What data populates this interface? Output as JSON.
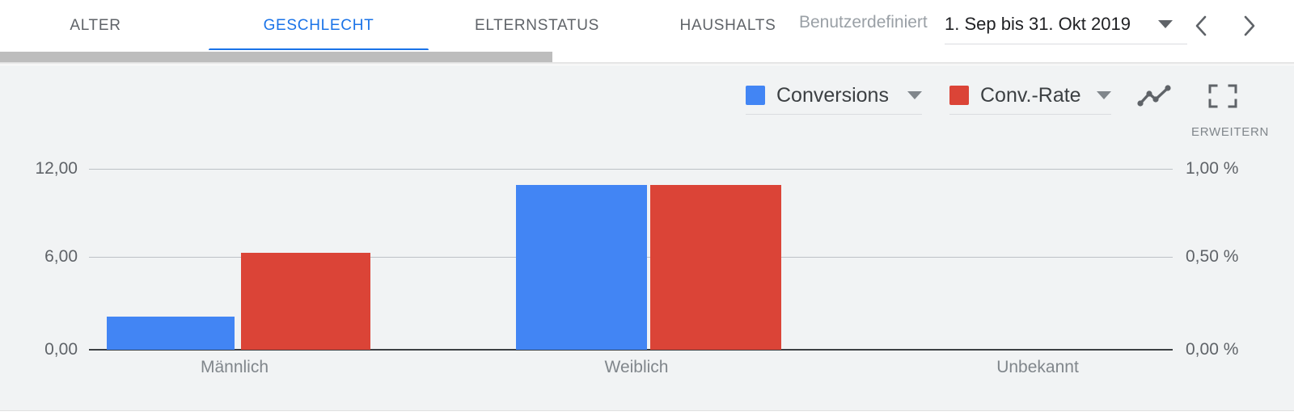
{
  "header": {
    "tabs": [
      {
        "label": "ALTER",
        "active": false
      },
      {
        "label": "GESCHLECHT",
        "active": true
      },
      {
        "label": "ELTERNSTATUS",
        "active": false
      },
      {
        "label": "HAUSHALTS",
        "active": false
      }
    ],
    "date_picker": {
      "label": "Benutzerdefiniert",
      "value": "1. Sep bis 31. Okt 2019",
      "dropdown_icon": "chevron-down-icon",
      "prev_icon": "chevron-left-icon",
      "next_icon": "chevron-right-icon"
    }
  },
  "toolbar": {
    "legend": [
      {
        "label": "Conversions",
        "color": "#4285F4",
        "dropdown_icon": "chevron-down-icon"
      },
      {
        "label": "Conv.-Rate",
        "color": "#DB4437",
        "dropdown_icon": "chevron-down-icon"
      }
    ],
    "line_chart_icon": "line-chart-icon",
    "expand_icon": "expand-icon",
    "expand_label": "ERWEITERN"
  },
  "chart_data": {
    "type": "bar",
    "title": "",
    "categories": [
      "Männlich",
      "Weiblich",
      "Unbekannt"
    ],
    "series": [
      {
        "name": "Conversions",
        "color": "#4285F4",
        "axis": "left",
        "values": [
          1.4,
          11.2,
          0
        ]
      },
      {
        "name": "Conv.-Rate",
        "color": "#DB4437",
        "axis": "right",
        "values": [
          0.53,
          0.95,
          0
        ]
      }
    ],
    "left_axis": {
      "ticks": [
        "0,00",
        "6,00",
        "12,00"
      ],
      "tick_values": [
        0,
        6,
        12
      ],
      "min": 0,
      "max": 13.0
    },
    "right_axis": {
      "ticks": [
        "0,00 %",
        "0,50 %",
        "1,00 %"
      ],
      "tick_values": [
        0,
        0.5,
        1.0
      ],
      "min": 0,
      "max": 1.0833
    },
    "xlabel": "",
    "ylabel": "",
    "grid": true,
    "legend_position": "top-right"
  }
}
